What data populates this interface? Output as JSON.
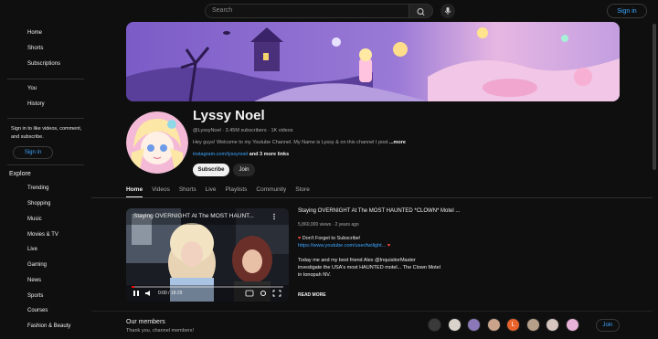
{
  "header": {
    "search_placeholder": "Search",
    "signin_label": "Sign in"
  },
  "sidebar": {
    "primary": [
      {
        "label": "Home",
        "icon": "home-icon"
      },
      {
        "label": "Shorts",
        "icon": "shorts-icon"
      },
      {
        "label": "Subscriptions",
        "icon": "subscriptions-icon"
      }
    ],
    "secondary": [
      {
        "label": "You",
        "icon": "you-icon"
      },
      {
        "label": "History",
        "icon": "history-icon"
      }
    ],
    "signin_prompt": "Sign in to like videos, comment, and subscribe.",
    "signin_label": "Sign in",
    "explore_heading": "Explore",
    "explore": [
      {
        "label": "Trending",
        "icon": "trending-icon"
      },
      {
        "label": "Shopping",
        "icon": "shopping-icon"
      },
      {
        "label": "Music",
        "icon": "music-icon"
      },
      {
        "label": "Movies & TV",
        "icon": "movies-icon"
      },
      {
        "label": "Live",
        "icon": "live-icon"
      },
      {
        "label": "Gaming",
        "icon": "gaming-icon"
      },
      {
        "label": "News",
        "icon": "news-icon"
      },
      {
        "label": "Sports",
        "icon": "sports-icon"
      },
      {
        "label": "Courses",
        "icon": "courses-icon"
      },
      {
        "label": "Fashion & Beauty",
        "icon": "fashion-icon"
      }
    ]
  },
  "channel": {
    "name": "Lyssy Noel",
    "meta": "@LyssyNoel · 3.45M subscribers · 1K videos",
    "description": "Hey guys! Welcome to my Youtube Channel. My Name is Lyssy & on this channel I post",
    "description_more": "...more",
    "link": "instagram.com/lyssynoel",
    "link_more": "and 3 more links",
    "subscribe_label": "Subscribe",
    "join_label": "Join"
  },
  "tabs": [
    {
      "label": "Home",
      "active": true
    },
    {
      "label": "Videos",
      "active": false
    },
    {
      "label": "Shorts",
      "active": false
    },
    {
      "label": "Live",
      "active": false
    },
    {
      "label": "Playlists",
      "active": false
    },
    {
      "label": "Community",
      "active": false
    },
    {
      "label": "Store",
      "active": false
    }
  ],
  "featured_video": {
    "overlay_title": "Staying OVERNIGHT At The MOST HAUNT...",
    "time": "0:00 / 18:29",
    "progress": 0.02,
    "title": "Staying OVERNIGHT At The MOST HAUNTED *CLOWN* Motel ...",
    "meta": "5,860,000 views · 2 years ago",
    "desc_line1": "Don't Forget to Subscribe!",
    "desc_link": "https://www.youtube.com/user/twilight...",
    "desc_line3": "Today me and my best friend Alex  @InquisitorMaster",
    "desc_line4": "investigate the USA's most HAUNTED motel... The Clown Motel",
    "desc_line5": "in tonopah NV.",
    "read_more": "READ MORE"
  },
  "members": {
    "title": "Our members",
    "subtitle": "Thank you, channel members!",
    "join_label": "Join",
    "avatars": [
      {
        "color": "#3a3a3a",
        "letter": ""
      },
      {
        "color": "#d9d3cc",
        "letter": ""
      },
      {
        "color": "#8a78b8",
        "letter": ""
      },
      {
        "color": "#c9a48a",
        "letter": ""
      },
      {
        "color": "#e8622c",
        "letter": "L"
      },
      {
        "color": "#b6a089",
        "letter": ""
      },
      {
        "color": "#d7c5c0",
        "letter": ""
      },
      {
        "color": "#e7b3d8",
        "letter": ""
      }
    ]
  },
  "colors": {
    "background": "#0f0f0f",
    "accent_link": "#3ea6ff",
    "text": "#f1f1f1",
    "muted": "#aaaaaa"
  }
}
